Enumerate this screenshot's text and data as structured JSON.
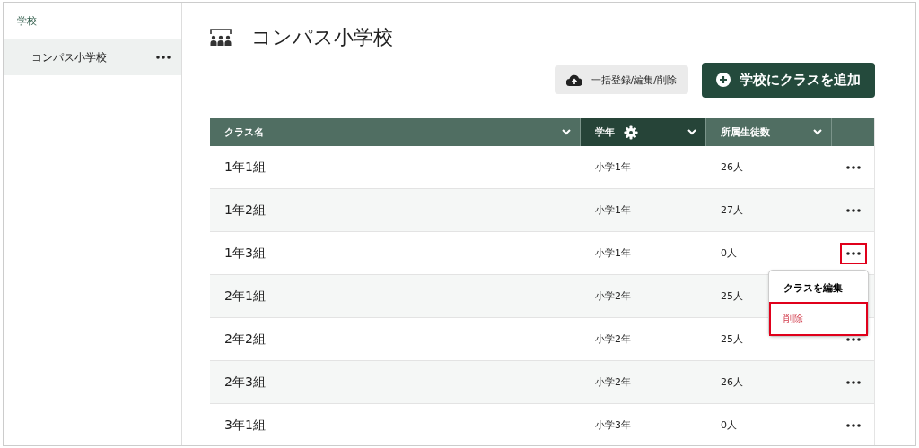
{
  "sidebar": {
    "heading": "学校",
    "items": [
      {
        "label": "コンパス小学校",
        "selected": true
      }
    ]
  },
  "page": {
    "title": "コンパス小学校"
  },
  "buttons": [
    {
      "kind": "secondary",
      "label": "一括登録/編集/削除"
    },
    {
      "kind": "primary",
      "label": "学校にクラスを追加"
    }
  ],
  "table": {
    "columns": [
      {
        "label": "クラス名",
        "selected": false,
        "settings": false
      },
      {
        "label": "学年",
        "selected": true,
        "settings": true
      },
      {
        "label": "所属生徒数",
        "selected": false,
        "settings": false
      }
    ],
    "rows": [
      {
        "name": "1年1組",
        "grade": "小学1年",
        "students": "26人",
        "actions": true,
        "highlighted": false,
        "menu_open": false
      },
      {
        "name": "1年2組",
        "grade": "小学1年",
        "students": "27人",
        "actions": true,
        "highlighted": false,
        "menu_open": false
      },
      {
        "name": "1年3組",
        "grade": "小学1年",
        "students": "0人",
        "actions": true,
        "highlighted": true,
        "menu_open": true
      },
      {
        "name": "2年1組",
        "grade": "小学2年",
        "students": "25人",
        "actions": false,
        "menu_open": false
      },
      {
        "name": "2年2組",
        "grade": "小学2年",
        "students": "25人",
        "actions": true,
        "highlighted": false,
        "menu_open": false
      },
      {
        "name": "2年3組",
        "grade": "小学2年",
        "students": "26人",
        "actions": true,
        "highlighted": false,
        "menu_open": false
      },
      {
        "name": "3年1組",
        "grade": "小学3年",
        "students": "0人",
        "actions": true,
        "highlighted": false,
        "menu_open": false
      }
    ]
  },
  "menu": {
    "items": [
      {
        "kind": "normal",
        "label": "クラスを編集",
        "highlighted": false
      },
      {
        "kind": "danger",
        "label": "削除",
        "highlighted": true
      }
    ]
  }
}
